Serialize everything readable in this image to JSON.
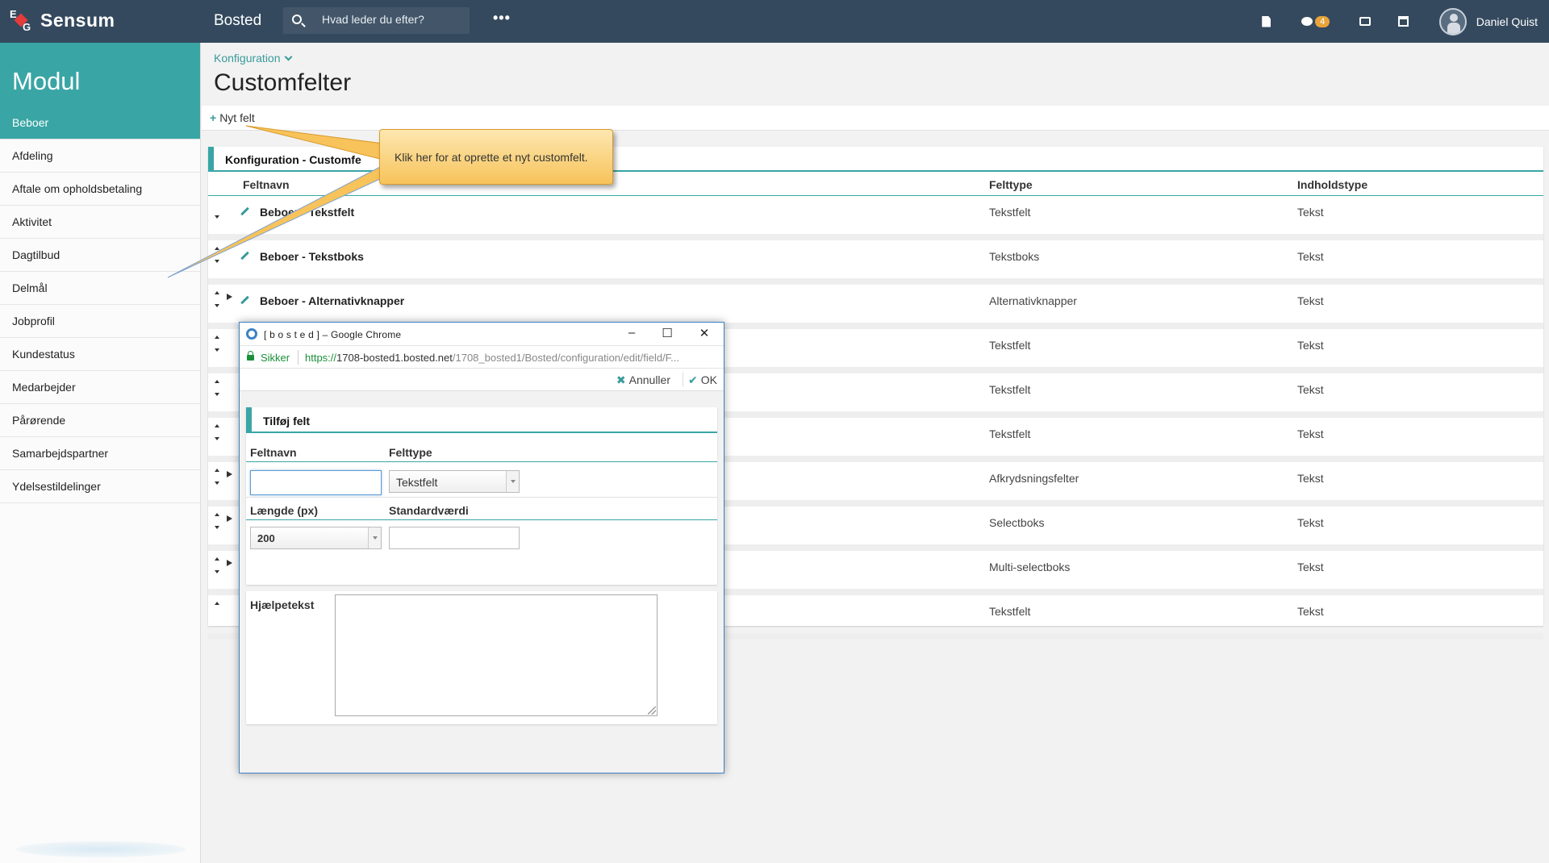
{
  "header": {
    "brand": "Sensum",
    "app_name": "Bosted",
    "search_placeholder": "Hvad leder du efter?",
    "more_label": "•••",
    "notification_count": "4",
    "user_name": "Daniel Quist"
  },
  "sidebar": {
    "title": "Modul",
    "items": [
      {
        "label": "Beboer",
        "active": true
      },
      {
        "label": "Afdeling"
      },
      {
        "label": "Aftale om opholdsbetaling"
      },
      {
        "label": "Aktivitet"
      },
      {
        "label": "Dagtilbud"
      },
      {
        "label": "Delmål"
      },
      {
        "label": "Jobprofil"
      },
      {
        "label": "Kundestatus"
      },
      {
        "label": "Medarbejder"
      },
      {
        "label": "Pårørende"
      },
      {
        "label": "Samarbejdspartner"
      },
      {
        "label": "Ydelsestildelinger"
      }
    ]
  },
  "page": {
    "breadcrumb": "Konfiguration",
    "title": "Customfelter",
    "new_field_label": "Nyt felt"
  },
  "panel": {
    "title": "Konfiguration - Customfe",
    "columns": {
      "name": "Feltnavn",
      "type": "Felttype",
      "content": "Indholdstype"
    },
    "rows": [
      {
        "name": "Beboer - Tekstfelt",
        "type": "Tekstfelt",
        "content": "Tekst"
      },
      {
        "name": "Beboer - Tekstboks",
        "type": "Tekstboks",
        "content": "Tekst"
      },
      {
        "name": "Beboer - Alternativknapper",
        "type": "Alternativknapper",
        "content": "Tekst"
      },
      {
        "name": "",
        "type": "Tekstfelt",
        "content": "Tekst"
      },
      {
        "name": "",
        "type": "Tekstfelt",
        "content": "Tekst"
      },
      {
        "name": "",
        "type": "Tekstfelt",
        "content": "Tekst"
      },
      {
        "name": "",
        "type": "Afkrydsningsfelter",
        "content": "Tekst"
      },
      {
        "name": "",
        "type": "Selectboks",
        "content": "Tekst"
      },
      {
        "name": "",
        "type": "Multi-selectboks",
        "content": "Tekst"
      },
      {
        "name": "",
        "type": "Tekstfelt",
        "content": "Tekst"
      }
    ]
  },
  "tooltip": {
    "text": "Klik her for at oprette et nyt customfelt."
  },
  "popup": {
    "window_title": "[ b o s t e d ] – Google Chrome",
    "secure_label": "Sikker",
    "url_scheme": "https://",
    "url_host": "1708-bosted1.bosted.net",
    "url_path": "/1708_bosted1/Bosted/configuration/edit/field/F...",
    "cancel_label": "Annuller",
    "ok_label": "OK",
    "form_title": "Tilføj felt",
    "field_name_label": "Feltnavn",
    "field_type_label": "Felttype",
    "field_type_value": "Tekstfelt",
    "length_label": "Længde (px)",
    "length_value": "200",
    "default_label": "Standardværdi",
    "help_label": "Hjælpetekst"
  },
  "colors": {
    "topbar": "#34495e",
    "accent": "#3aa5a5",
    "badge": "#e8a33a",
    "tooltip": "#f7c35a"
  }
}
